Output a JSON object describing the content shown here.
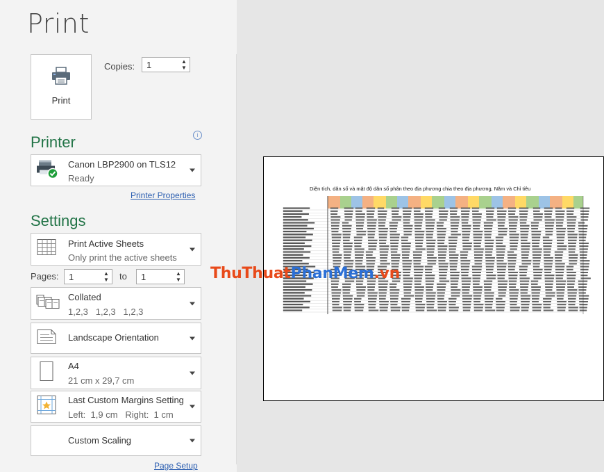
{
  "page_title": "Print",
  "print_button": {
    "label": "Print"
  },
  "copies": {
    "label": "Copies:",
    "value": "1"
  },
  "printer": {
    "section_title": "Printer",
    "name": "Canon LBP2900 on TLS12",
    "status": "Ready",
    "properties_link": "Printer Properties"
  },
  "settings": {
    "section_title": "Settings",
    "scope": {
      "line1": "Print Active Sheets",
      "line2": "Only print the active sheets"
    },
    "pages": {
      "label": "Pages:",
      "from": "1",
      "to_label": "to",
      "to": "1"
    },
    "collation": {
      "line1": "Collated",
      "line2": "1,2,3   1,2,3   1,2,3"
    },
    "orientation": {
      "line1": "Landscape Orientation"
    },
    "paper": {
      "line1": "A4",
      "line2": "21 cm x 29,7 cm"
    },
    "margins": {
      "line1": "Last Custom Margins Setting",
      "line2": "Left:  1,9 cm   Right:  1 cm"
    },
    "scaling": {
      "line1": "Custom Scaling"
    },
    "page_setup_link": "Page Setup"
  },
  "preview": {
    "sheet_title": "Diện tích, dân số và mật độ dân số phân theo địa phương chia theo địa phương, Năm và Chỉ tiêu",
    "watermark_part1": "ThuThuat",
    "watermark_part2": "PhanMem",
    "watermark_part3": ".vn"
  },
  "colors": {
    "accent": "#217346",
    "link": "#2a5db0",
    "status_ok": "#1e9e3a"
  },
  "icons": {
    "print_button": "printer-icon",
    "printer": "printer-ready-icon",
    "scope": "sheet-grid-icon",
    "collation": "collate-icon",
    "orientation": "landscape-page-icon",
    "paper": "portrait-page-icon",
    "margins": "margins-icon",
    "info": "info-icon"
  }
}
